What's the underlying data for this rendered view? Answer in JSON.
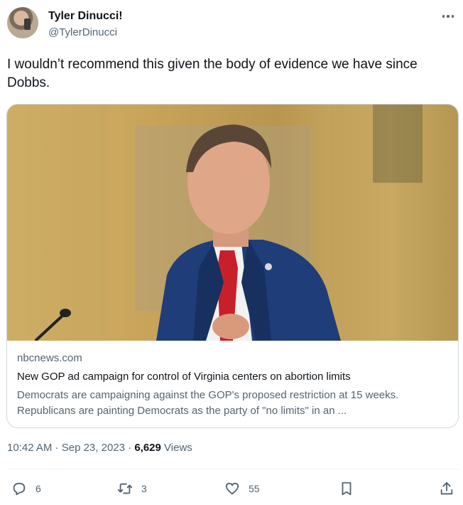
{
  "author": {
    "name": "Tyler Dinucci!",
    "handle": "@TylerDinucci"
  },
  "tweet": {
    "text": "I wouldn’t recommend this given the body of evidence we have since Dobbs."
  },
  "card": {
    "domain": "nbcnews.com",
    "title": "New GOP ad campaign for control of Virginia centers on abortion limits",
    "description": "Democrats are campaigning against the GOP's proposed restriction at 15 weeks. Republicans are painting Democrats as the party of \"no limits\" in an ..."
  },
  "meta": {
    "time": "10:42 AM",
    "separator": " · ",
    "date": "Sep 23, 2023",
    "views_count": "6,629",
    "views_label": " Views"
  },
  "actions": {
    "replies": "6",
    "retweets": "3",
    "likes": "55"
  },
  "icons": [
    "more-icon",
    "reply-icon",
    "retweet-icon",
    "like-icon",
    "bookmark-icon",
    "share-icon"
  ]
}
